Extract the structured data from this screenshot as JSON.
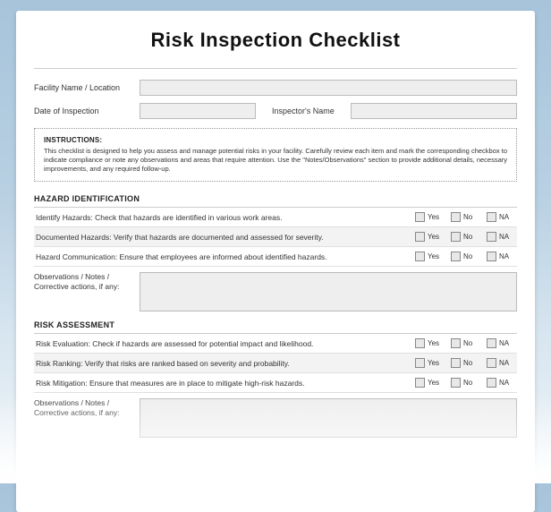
{
  "title": "Risk Inspection Checklist",
  "fields": {
    "facility_label": "Facility Name / Location",
    "date_label": "Date of Inspection",
    "inspector_label": "Inspector's Name",
    "facility_value": "",
    "date_value": "",
    "inspector_value": ""
  },
  "instructions": {
    "heading": "INSTRUCTIONS:",
    "body": "This checklist is designed to help you assess and manage potential risks in your facility. Carefully review each item and mark the corresponding checkbox to indicate compliance or note any observations and areas that require attention. Use the \"Notes/Observations\" section to provide additional details, necessary improvements, and any required follow-up."
  },
  "option_labels": {
    "yes": "Yes",
    "no": "No",
    "na": "NA"
  },
  "notes_label": "Observations / Notes / Corrective actions, if any:",
  "sections": [
    {
      "header": "HAZARD IDENTIFICATION",
      "items": [
        "Identify Hazards: Check that hazards are identified in various work areas.",
        "Documented Hazards: Verify that hazards are documented and assessed for severity.",
        "Hazard Communication: Ensure that employees are informed about identified hazards."
      ]
    },
    {
      "header": "RISK ASSESSMENT",
      "items": [
        "Risk Evaluation: Check if hazards are assessed for potential impact and likelihood.",
        "Risk Ranking: Verify that risks are ranked based on severity and probability.",
        "Risk Mitigation: Ensure that measures are in place to mitigate high-risk hazards."
      ]
    }
  ]
}
